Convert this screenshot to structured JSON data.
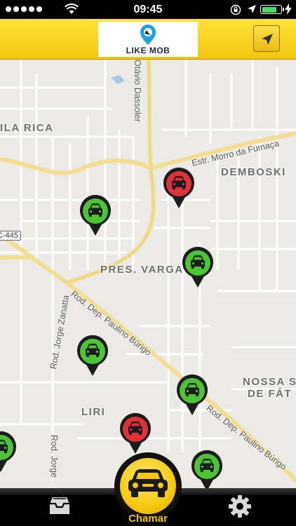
{
  "status_bar": {
    "time": "09:45"
  },
  "header": {
    "logo_text": "LIKE MOB"
  },
  "map": {
    "areas": [
      "ILA RICA",
      "DEMBOSKI",
      "PRES. VARGA",
      "NOSSA S",
      "DE FÁT",
      "LIRI"
    ],
    "roads": [
      "Otávio Dassoler",
      "Estr. Morro da Fumaça",
      "Rod. Dep. Paulino Búrigo",
      "Rod. Dep. Paulino Búrigo",
      "Rod. Jorge Zanatta",
      "Rod. Jorge"
    ],
    "shields": [
      "C-445"
    ],
    "markers": [
      {
        "status": "available",
        "color": "#4cc535"
      },
      {
        "status": "occupied",
        "color": "#e0313a"
      },
      {
        "status": "available",
        "color": "#4cc535"
      },
      {
        "status": "available",
        "color": "#4cc535"
      },
      {
        "status": "available",
        "color": "#4cc535"
      },
      {
        "status": "occupied",
        "color": "#e0313a"
      },
      {
        "status": "available",
        "color": "#4cc535"
      },
      {
        "status": "available",
        "color": "#4cc535"
      }
    ]
  },
  "tab_bar": {
    "call_label": "Chamar"
  },
  "colors": {
    "brand_yellow": "#f6c90e",
    "available": "#4cc535",
    "occupied": "#e0313a"
  }
}
